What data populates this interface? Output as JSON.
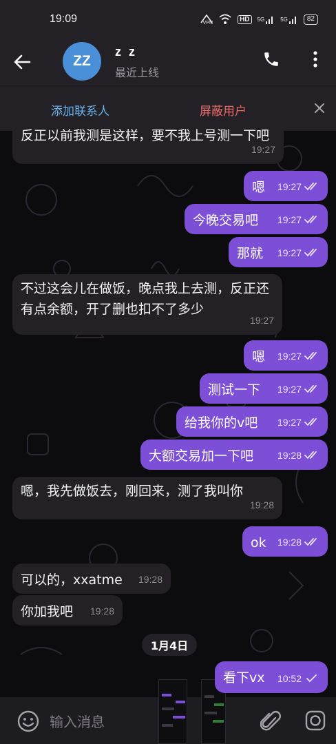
{
  "status_bar": {
    "time": "19:09",
    "vpn": "VPN",
    "hd": "HD",
    "net1": "5G",
    "net2": "5G",
    "battery": "82"
  },
  "header": {
    "avatar_initials": "ZZ",
    "contact_name": "z z",
    "last_seen": "最近上线",
    "accent": "#4a90d9"
  },
  "action_bar": {
    "add_contact": "添加联系人",
    "block_user": "屏蔽用户"
  },
  "messages": [
    {
      "dir": "in",
      "text": "反正以前我测是这样，要不我上号测一下吧",
      "time": "19:27"
    },
    {
      "dir": "out",
      "text": "嗯",
      "time": "19:27",
      "read": true
    },
    {
      "dir": "out",
      "text": "今晚交易吧",
      "time": "19:27",
      "read": true
    },
    {
      "dir": "out",
      "text": "那就",
      "time": "19:27",
      "read": true
    },
    {
      "dir": "in",
      "text": "不过这会儿在做饭，晚点我上去测，反正还有点余额，开了删也扣不了多少",
      "time": "19:27"
    },
    {
      "dir": "out",
      "text": "嗯",
      "time": "19:27",
      "read": true
    },
    {
      "dir": "out",
      "text": "测试一下",
      "time": "19:27",
      "read": true
    },
    {
      "dir": "out",
      "text": "给我你的v吧",
      "time": "19:27",
      "read": true
    },
    {
      "dir": "out",
      "text": "大额交易加一下吧",
      "time": "19:28",
      "read": true
    },
    {
      "dir": "in",
      "text": "嗯，我先做饭去，刚回来，测了我叫你",
      "time": "19:28"
    },
    {
      "dir": "out",
      "text": "ok",
      "time": "19:28",
      "read": true
    },
    {
      "dir": "in",
      "text": "可以的，xxatme",
      "time": "19:28"
    },
    {
      "dir": "in",
      "text": "你加我吧",
      "time": "19:28"
    },
    {
      "dir": "out",
      "text": "看下vx",
      "time": "10:52",
      "read": false
    }
  ],
  "date_separator": "1月4日",
  "input": {
    "placeholder": "输入消息"
  },
  "colors": {
    "outgoing_bubble": "#7c4fd6",
    "incoming_bubble": "#232126",
    "header_bg": "#242126",
    "add_contact": "#6ab4f0",
    "block_user": "#ec6a67"
  }
}
